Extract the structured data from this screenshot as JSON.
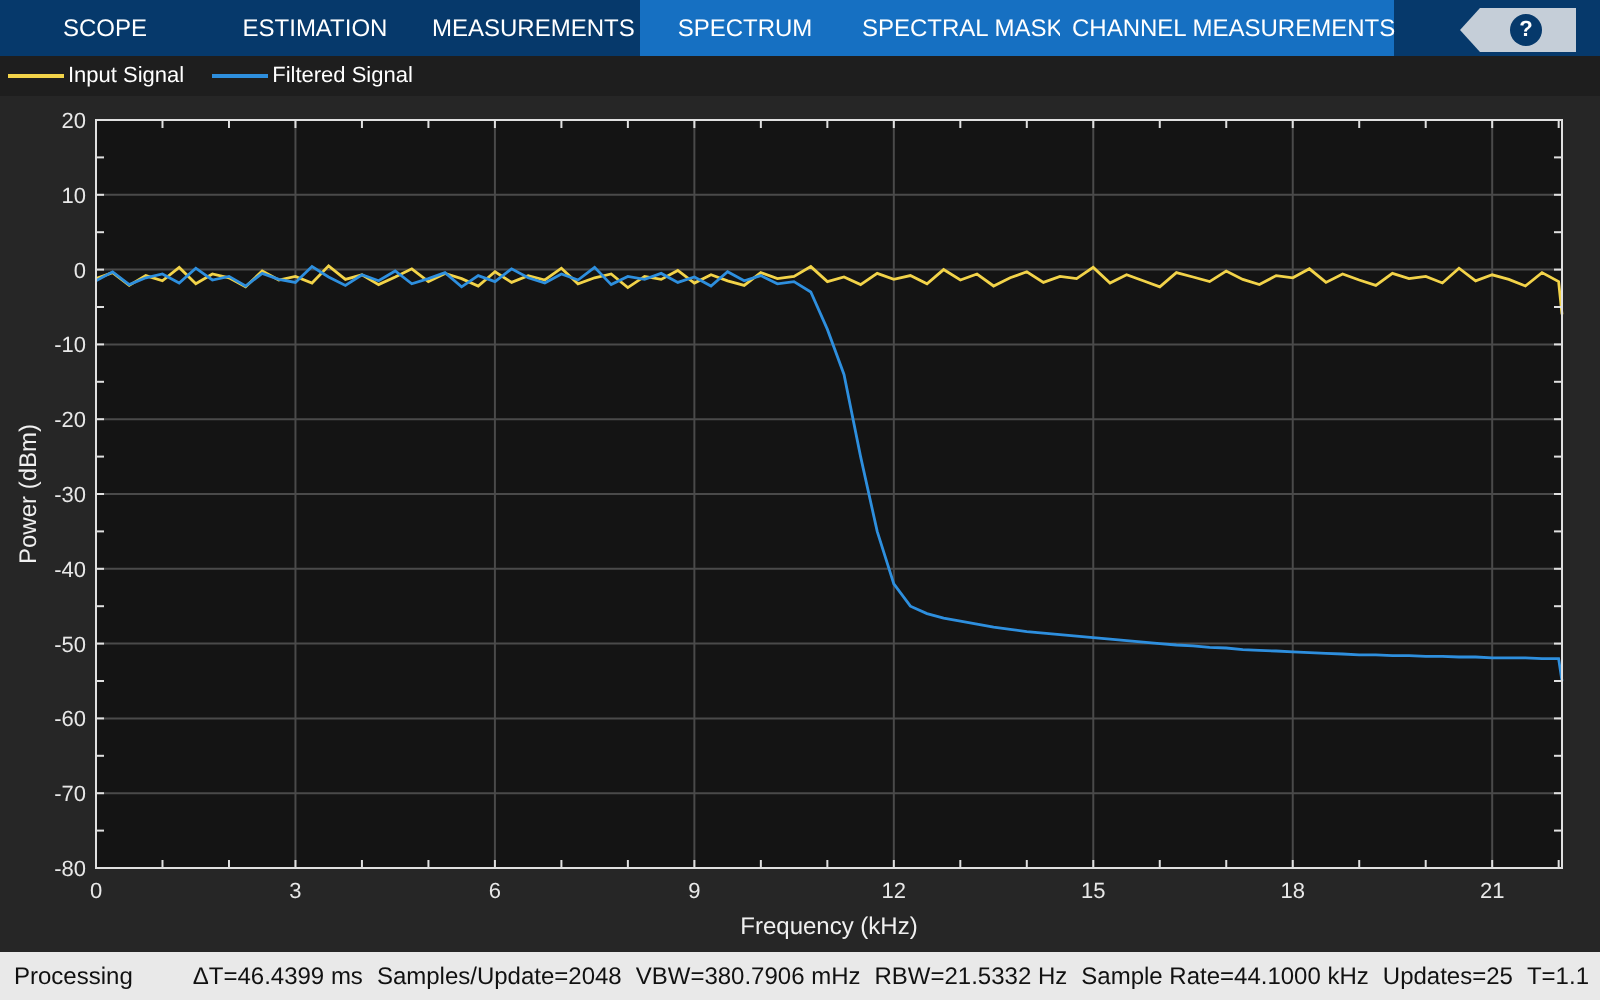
{
  "tabs": [
    {
      "label": "SCOPE",
      "kind": "standard"
    },
    {
      "label": "ESTIMATION",
      "kind": "standard"
    },
    {
      "label": "MEASUREMENTS",
      "kind": "standard"
    },
    {
      "label": "SPECTRUM",
      "kind": "contextual"
    },
    {
      "label": "SPECTRAL MASK",
      "kind": "contextual"
    },
    {
      "label": "CHANNEL MEASUREMENTS",
      "kind": "contextual"
    }
  ],
  "help_button": {
    "label": "?"
  },
  "chart_data": {
    "type": "line",
    "grid": true,
    "xlabel": "Frequency (kHz)",
    "ylabel": "Power (dBm)",
    "x": [
      0,
      0.25,
      0.5,
      0.75,
      1,
      1.25,
      1.5,
      1.75,
      2,
      2.25,
      2.5,
      2.75,
      3,
      3.25,
      3.5,
      3.75,
      4,
      4.25,
      4.5,
      4.75,
      5,
      5.25,
      5.5,
      5.75,
      6,
      6.25,
      6.5,
      6.75,
      7,
      7.25,
      7.5,
      7.75,
      8,
      8.25,
      8.5,
      8.75,
      9,
      9.25,
      9.5,
      9.75,
      10,
      10.25,
      10.5,
      10.75,
      11,
      11.25,
      11.5,
      11.75,
      12,
      12.25,
      12.5,
      12.75,
      13,
      13.25,
      13.5,
      13.75,
      14,
      14.25,
      14.5,
      14.75,
      15,
      15.25,
      15.5,
      15.75,
      16,
      16.25,
      16.5,
      16.75,
      17,
      17.25,
      17.5,
      17.75,
      18,
      18.25,
      18.5,
      18.75,
      19,
      19.25,
      19.5,
      19.75,
      20,
      20.25,
      20.5,
      20.75,
      21,
      21.25,
      21.5,
      21.75,
      22,
      22.05
    ],
    "series": [
      {
        "name": "Input Signal",
        "color": "#f2d349",
        "values": [
          -1.2,
          -0.4,
          -2.1,
          -0.8,
          -1.5,
          0.3,
          -1.9,
          -0.6,
          -1.1,
          -2.3,
          -0.2,
          -1.4,
          -0.9,
          -1.8,
          0.5,
          -1.3,
          -0.7,
          -2.0,
          -1.0,
          0.1,
          -1.6,
          -0.5,
          -1.2,
          -2.2,
          -0.3,
          -1.7,
          -0.8,
          -1.4,
          0.2,
          -1.9,
          -1.1,
          -0.6,
          -2.4,
          -0.9,
          -1.3,
          -0.1,
          -1.8,
          -0.7,
          -1.5,
          -2.1,
          -0.4,
          -1.2,
          -0.9,
          0.4,
          -1.6,
          -1.0,
          -2.0,
          -0.5,
          -1.3,
          -0.8,
          -1.9,
          0.0,
          -1.4,
          -0.6,
          -2.2,
          -1.1,
          -0.3,
          -1.7,
          -0.9,
          -1.2,
          0.3,
          -1.8,
          -0.7,
          -1.5,
          -2.3,
          -0.4,
          -1.0,
          -1.6,
          -0.2,
          -1.3,
          -2.0,
          -0.8,
          -1.1,
          0.1,
          -1.7,
          -0.6,
          -1.4,
          -2.1,
          -0.5,
          -1.2,
          -0.9,
          -1.8,
          0.2,
          -1.5,
          -0.7,
          -1.3,
          -2.2,
          -0.4,
          -1.6,
          -6.0
        ]
      },
      {
        "name": "Filtered Signal",
        "color": "#2e8fde",
        "values": [
          -1.5,
          -0.3,
          -2.0,
          -1.1,
          -0.6,
          -1.8,
          0.2,
          -1.4,
          -0.9,
          -2.2,
          -0.5,
          -1.3,
          -1.7,
          0.4,
          -1.0,
          -2.1,
          -0.7,
          -1.5,
          -0.2,
          -1.9,
          -1.2,
          -0.4,
          -2.3,
          -0.8,
          -1.6,
          0.1,
          -1.1,
          -1.8,
          -0.6,
          -1.4,
          0.3,
          -2.0,
          -0.9,
          -1.3,
          -0.5,
          -1.7,
          -1.0,
          -2.2,
          -0.3,
          -1.5,
          -0.8,
          -1.9,
          -1.6,
          -3.0,
          -8,
          -14,
          -25,
          -35,
          -42,
          -45,
          -46,
          -46.6,
          -47,
          -47.4,
          -47.8,
          -48.1,
          -48.4,
          -48.6,
          -48.8,
          -49.0,
          -49.2,
          -49.4,
          -49.6,
          -49.8,
          -50.0,
          -50.2,
          -50.3,
          -50.5,
          -50.6,
          -50.8,
          -50.9,
          -51.0,
          -51.1,
          -51.2,
          -51.3,
          -51.4,
          -51.5,
          -51.5,
          -51.6,
          -51.6,
          -51.7,
          -51.7,
          -51.8,
          -51.8,
          -51.9,
          -51.9,
          -51.9,
          -52.0,
          -52.0,
          -55.0
        ]
      }
    ],
    "xlim": [
      0,
      22.05
    ],
    "ylim": [
      -80,
      20
    ],
    "xticks": [
      0,
      3,
      6,
      9,
      12,
      15,
      18,
      21
    ],
    "yticks": [
      -80,
      -70,
      -60,
      -50,
      -40,
      -30,
      -20,
      -10,
      0,
      10,
      20
    ]
  },
  "status_bar": {
    "state": "Processing",
    "items": [
      "ΔT=46.4399 ms",
      "Samples/Update=2048",
      "VBW=380.7906 mHz",
      "RBW=21.5332 Hz",
      "Sample Rate=44.1000 kHz",
      "Updates=25",
      "T=1.1"
    ]
  }
}
